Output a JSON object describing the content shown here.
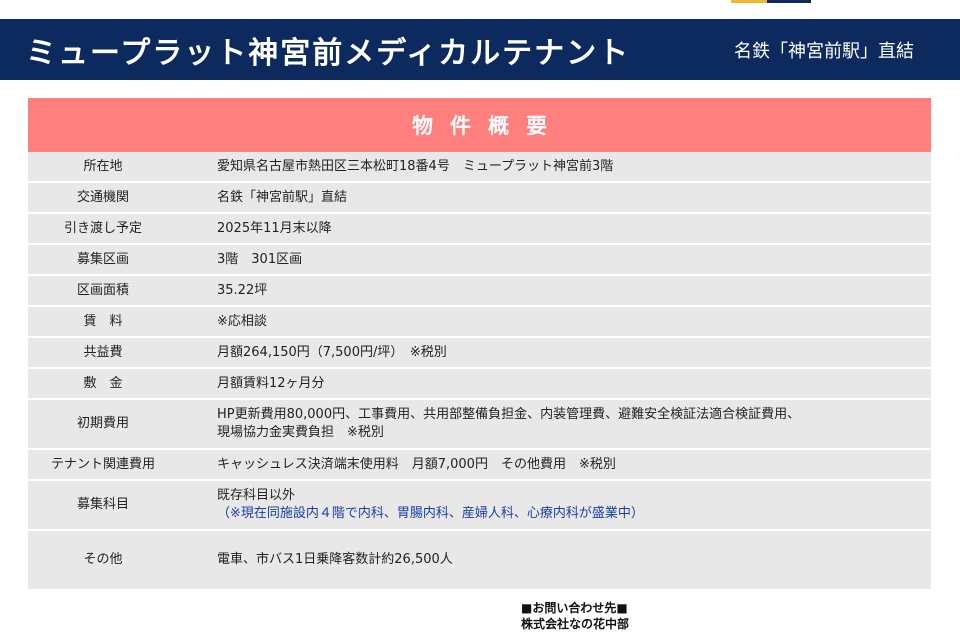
{
  "colors": {
    "header_bg": "#0d2a5e",
    "section_bg": "#ff7f7f",
    "row_bg": "#e8e8e8",
    "note_text": "#1c3ca8",
    "accent_left": "#f2b636",
    "accent_right": "#0d2a5e"
  },
  "header": {
    "title": "ミュープラット神宮前メディカルテナント",
    "station": "名鉄「神宮前駅」直結"
  },
  "section": {
    "title": "物件概要"
  },
  "rows": [
    {
      "label": "所在地",
      "value": "愛知県名古屋市熱田区三本松町18番4号　ミュープラット神宮前3階"
    },
    {
      "label": "交通機関",
      "value": "名鉄「神宮前駅」直結"
    },
    {
      "label": "引き渡し予定",
      "value": "2025年11月末以降"
    },
    {
      "label": "募集区画",
      "value": "3階　301区画"
    },
    {
      "label": "区画面積",
      "value": "35.22坪"
    },
    {
      "label": "賃　料",
      "value": "※応相談"
    },
    {
      "label": "共益費",
      "value": "月額264,150円（7,500円/坪）　※税別"
    },
    {
      "label": "敷　金",
      "value": "月額賃料12ヶ月分"
    },
    {
      "label": "初期費用",
      "value": "HP更新費用80,000円、工事費用、共用部整備負担金、内装管理費、避難安全検証法適合検証費用、",
      "value2": "現場協力金実費負担　※税別"
    },
    {
      "label": "テナント関連費用",
      "value": "キャッシュレス決済端末使用料　月額7,000円　その他費用　※税別"
    },
    {
      "label": "募集科目",
      "value": "既存科目以外",
      "note": "（※現在同施設内４階で内科、胃腸内科、産婦人科、心療内科が盛業中）"
    },
    {
      "label": "その他",
      "value": "電車、市バス1日乗降客数計約26,500人"
    }
  ],
  "contact": {
    "heading": "■お問い合わせ先■",
    "company": "株式会社なの花中部"
  }
}
